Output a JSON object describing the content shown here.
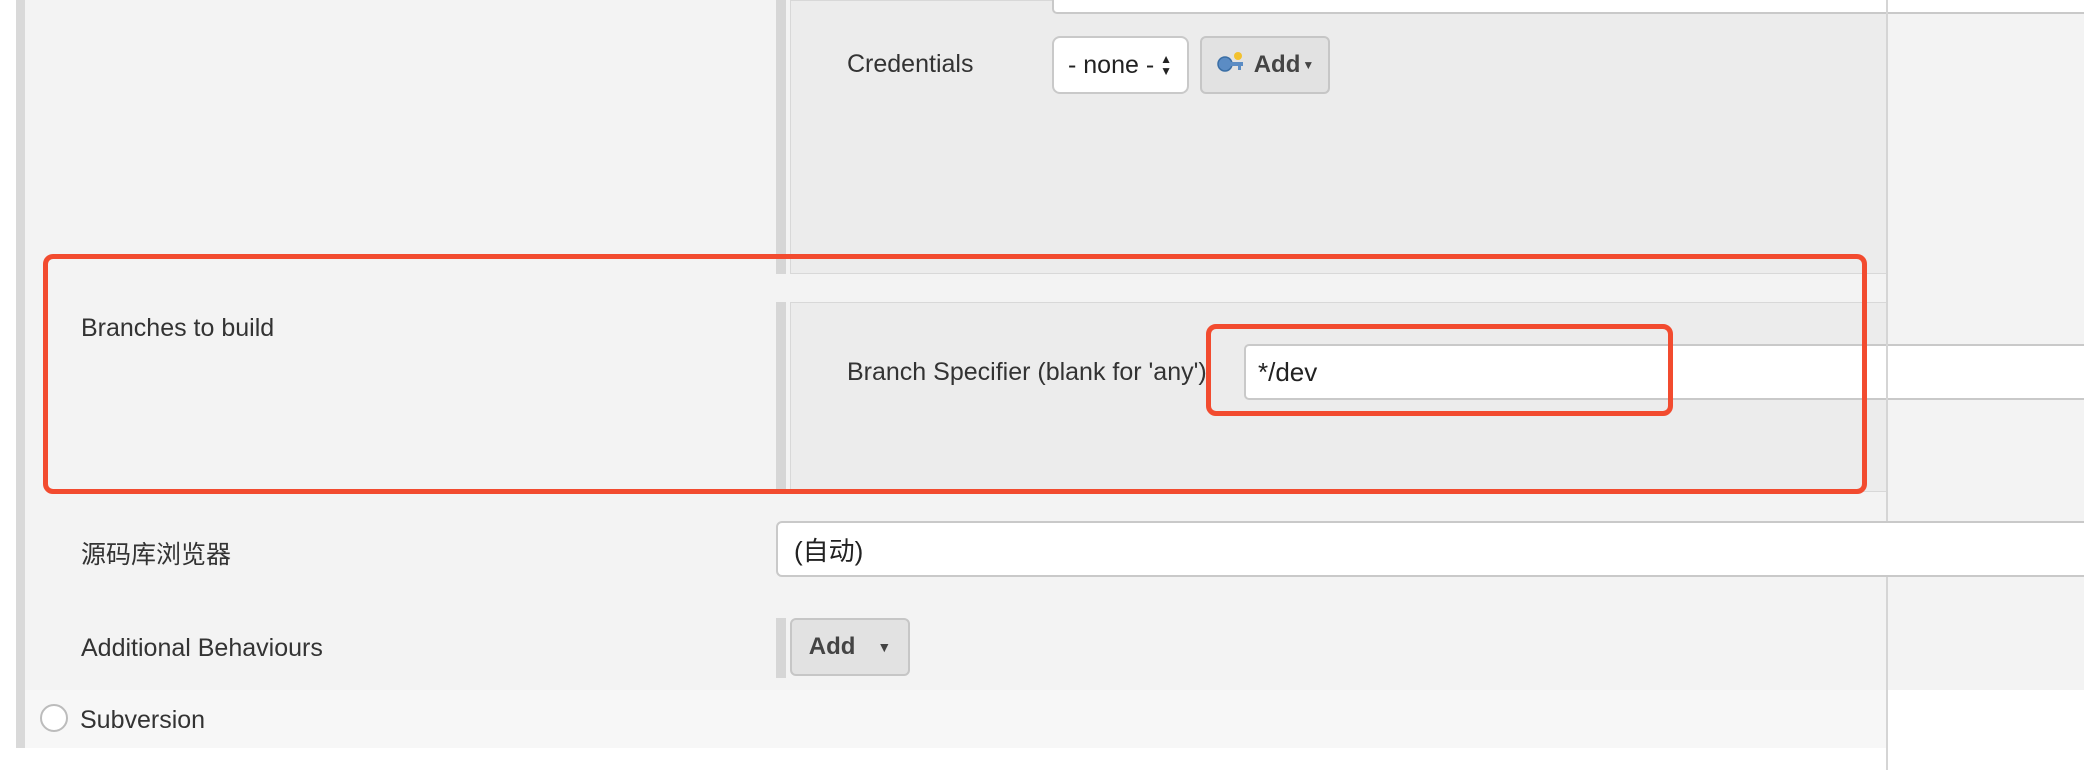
{
  "credentials": {
    "label": "Credentials",
    "select_value": "- none -",
    "add_button": "Add"
  },
  "branches": {
    "section_label": "Branches to build",
    "specifier_label": "Branch Specifier (blank for 'any')",
    "specifier_value": "*/dev"
  },
  "repo_browser": {
    "label": "源码库浏览器",
    "value": "(自动)"
  },
  "additional_behaviours": {
    "label": "Additional Behaviours",
    "add_button": "Add"
  },
  "scm_option": {
    "label": "Subversion"
  },
  "annotation_color": "#f24b2f"
}
